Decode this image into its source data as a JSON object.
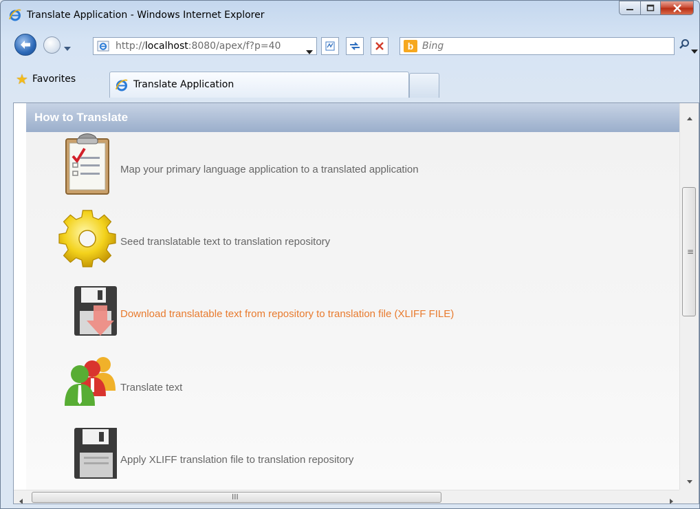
{
  "window": {
    "title": "Translate Application - Windows Internet Explorer"
  },
  "navigation": {
    "url_prefix": "http://",
    "url_host": "localhost",
    "url_rest": ":8080/apex/f?p=40",
    "search_placeholder": "Bing"
  },
  "favorites_bar": {
    "favorites_label": "Favorites",
    "tab_label": "Translate Application"
  },
  "region": {
    "title": "How to Translate",
    "steps": [
      {
        "label": "Map your primary language application to a translated application",
        "icon": "checklist-clipboard-icon"
      },
      {
        "label": "Seed translatable text to translation repository",
        "icon": "gear-icon"
      },
      {
        "label": "Download translatable text from repository to translation file (XLIFF FILE)",
        "icon": "download-floppy-icon"
      },
      {
        "label": "Translate text",
        "icon": "people-icon"
      },
      {
        "label": "Apply XLIFF translation file to translation repository",
        "icon": "floppy-disk-icon"
      }
    ]
  },
  "colors": {
    "region_header": "#9aaecb",
    "link_active": "#e87a2d",
    "text": "#666666"
  }
}
